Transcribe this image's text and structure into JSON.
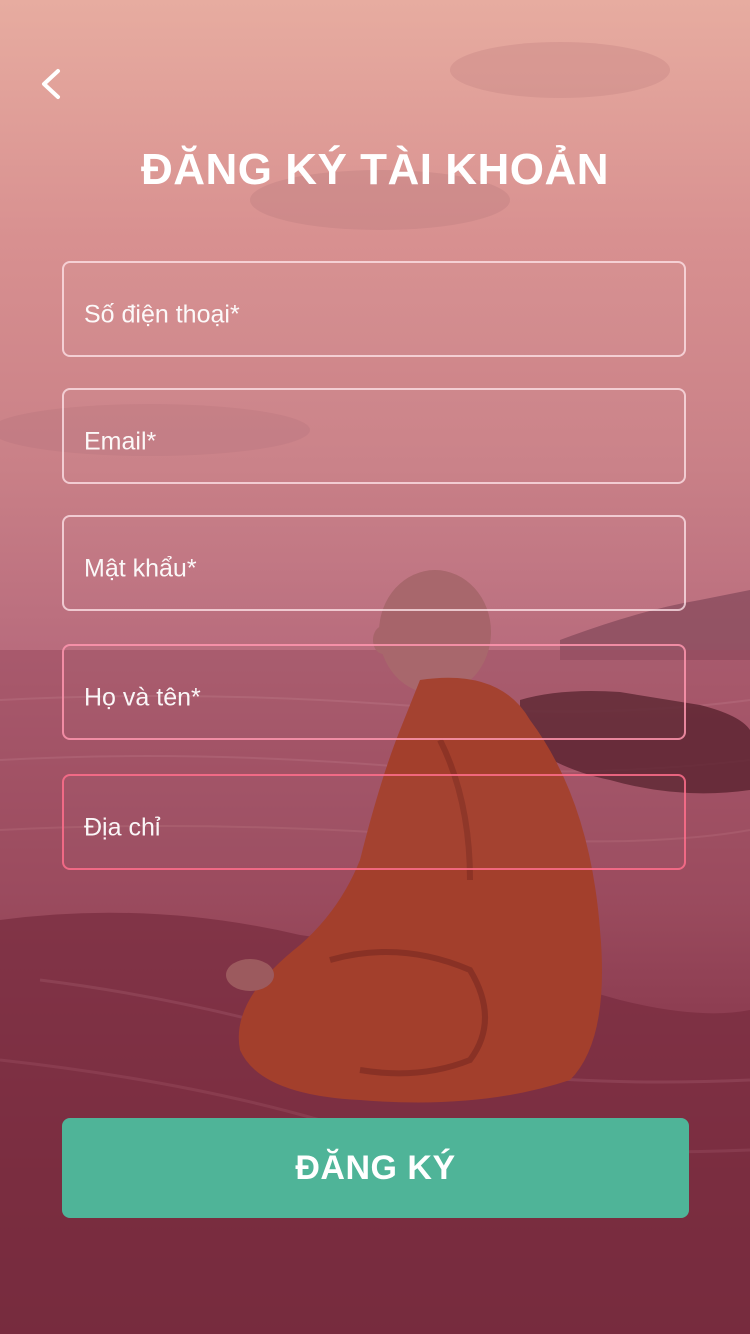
{
  "header": {
    "back_icon": "chevron-left-icon",
    "title": "ĐĂNG KÝ TÀI KHOẢN"
  },
  "form": {
    "fields": [
      {
        "placeholder": "Số điện thoại*",
        "value": ""
      },
      {
        "placeholder": "Email*",
        "value": ""
      },
      {
        "placeholder": "Mật khẩu*",
        "value": ""
      },
      {
        "placeholder": "Họ và tên*",
        "value": ""
      },
      {
        "placeholder": "Địa chỉ",
        "value": ""
      }
    ],
    "submit_label": "ĐĂNG KÝ"
  },
  "colors": {
    "accent": "#4fb498",
    "overlay_top": "#e7aca0",
    "overlay_bottom": "#70273a",
    "text": "#ffffff"
  }
}
